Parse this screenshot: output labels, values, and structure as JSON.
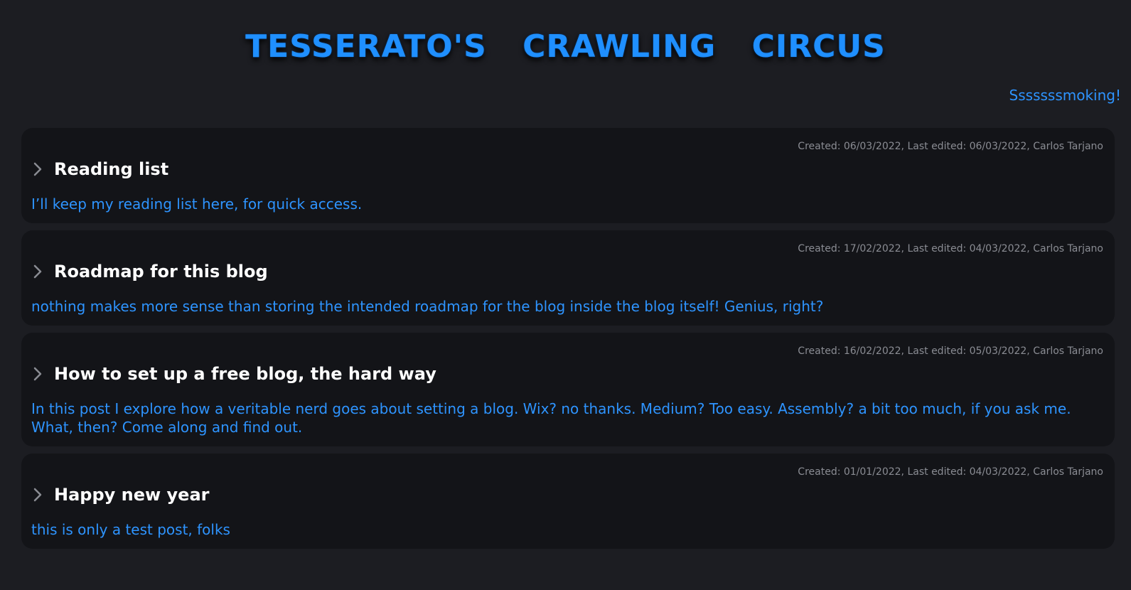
{
  "site": {
    "title": "TESSERATO'S CRAWLING CIRCUS",
    "tagline": "Sssssssmoking!"
  },
  "colors": {
    "background": "#1c1d22",
    "card": "#131418",
    "accent": "#2e94ff",
    "title_text": "#ffffff",
    "meta_text": "#8a8c93"
  },
  "posts": [
    {
      "meta": "Created: 06/03/2022, Last edited: 06/03/2022, Carlos Tarjano",
      "title": "Reading list",
      "summary": "I’ll keep my reading list here, for quick access.",
      "icon": "chevron-right-icon"
    },
    {
      "meta": "Created: 17/02/2022, Last edited: 04/03/2022, Carlos Tarjano",
      "title": "Roadmap for this blog",
      "summary": "nothing makes more sense than storing the intended roadmap for the blog inside the blog itself! Genius, right?",
      "icon": "chevron-right-icon"
    },
    {
      "meta": "Created: 16/02/2022, Last edited: 05/03/2022, Carlos Tarjano",
      "title": "How to set up a free blog, the hard way",
      "summary": "In this post I explore how a veritable nerd goes about setting a blog. Wix? no thanks. Medium? Too easy. Assembly? a bit too much, if you ask me. What, then? Come along and find out.",
      "icon": "chevron-right-icon"
    },
    {
      "meta": "Created: 01/01/2022, Last edited: 04/03/2022, Carlos Tarjano",
      "title": "Happy new year",
      "summary": "this is only a test post, folks",
      "icon": "chevron-right-icon"
    }
  ]
}
